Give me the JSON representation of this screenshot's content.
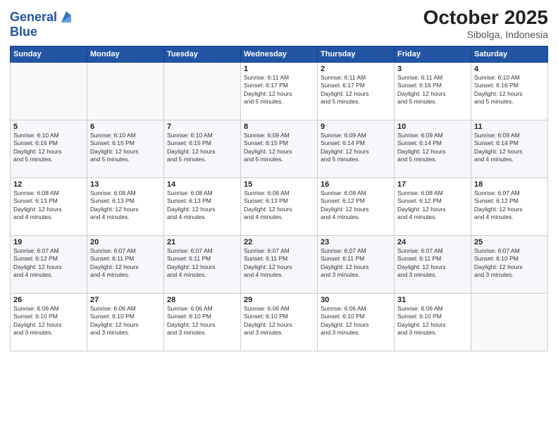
{
  "header": {
    "logo_line1": "General",
    "logo_line2": "Blue",
    "month": "October 2025",
    "location": "Sibolga, Indonesia"
  },
  "days_of_week": [
    "Sunday",
    "Monday",
    "Tuesday",
    "Wednesday",
    "Thursday",
    "Friday",
    "Saturday"
  ],
  "weeks": [
    [
      {
        "day": "",
        "info": ""
      },
      {
        "day": "",
        "info": ""
      },
      {
        "day": "",
        "info": ""
      },
      {
        "day": "1",
        "info": "Sunrise: 6:11 AM\nSunset: 6:17 PM\nDaylight: 12 hours\nand 5 minutes."
      },
      {
        "day": "2",
        "info": "Sunrise: 6:11 AM\nSunset: 6:17 PM\nDaylight: 12 hours\nand 5 minutes."
      },
      {
        "day": "3",
        "info": "Sunrise: 6:11 AM\nSunset: 6:16 PM\nDaylight: 12 hours\nand 5 minutes."
      },
      {
        "day": "4",
        "info": "Sunrise: 6:10 AM\nSunset: 6:16 PM\nDaylight: 12 hours\nand 5 minutes."
      }
    ],
    [
      {
        "day": "5",
        "info": "Sunrise: 6:10 AM\nSunset: 6:16 PM\nDaylight: 12 hours\nand 5 minutes."
      },
      {
        "day": "6",
        "info": "Sunrise: 6:10 AM\nSunset: 6:15 PM\nDaylight: 12 hours\nand 5 minutes."
      },
      {
        "day": "7",
        "info": "Sunrise: 6:10 AM\nSunset: 6:15 PM\nDaylight: 12 hours\nand 5 minutes."
      },
      {
        "day": "8",
        "info": "Sunrise: 6:09 AM\nSunset: 6:15 PM\nDaylight: 12 hours\nand 5 minutes."
      },
      {
        "day": "9",
        "info": "Sunrise: 6:09 AM\nSunset: 6:14 PM\nDaylight: 12 hours\nand 5 minutes."
      },
      {
        "day": "10",
        "info": "Sunrise: 6:09 AM\nSunset: 6:14 PM\nDaylight: 12 hours\nand 5 minutes."
      },
      {
        "day": "11",
        "info": "Sunrise: 6:09 AM\nSunset: 6:14 PM\nDaylight: 12 hours\nand 4 minutes."
      }
    ],
    [
      {
        "day": "12",
        "info": "Sunrise: 6:08 AM\nSunset: 6:13 PM\nDaylight: 12 hours\nand 4 minutes."
      },
      {
        "day": "13",
        "info": "Sunrise: 6:08 AM\nSunset: 6:13 PM\nDaylight: 12 hours\nand 4 minutes."
      },
      {
        "day": "14",
        "info": "Sunrise: 6:08 AM\nSunset: 6:13 PM\nDaylight: 12 hours\nand 4 minutes."
      },
      {
        "day": "15",
        "info": "Sunrise: 6:08 AM\nSunset: 6:13 PM\nDaylight: 12 hours\nand 4 minutes."
      },
      {
        "day": "16",
        "info": "Sunrise: 6:08 AM\nSunset: 6:12 PM\nDaylight: 12 hours\nand 4 minutes."
      },
      {
        "day": "17",
        "info": "Sunrise: 6:08 AM\nSunset: 6:12 PM\nDaylight: 12 hours\nand 4 minutes."
      },
      {
        "day": "18",
        "info": "Sunrise: 6:07 AM\nSunset: 6:12 PM\nDaylight: 12 hours\nand 4 minutes."
      }
    ],
    [
      {
        "day": "19",
        "info": "Sunrise: 6:07 AM\nSunset: 6:12 PM\nDaylight: 12 hours\nand 4 minutes."
      },
      {
        "day": "20",
        "info": "Sunrise: 6:07 AM\nSunset: 6:11 PM\nDaylight: 12 hours\nand 4 minutes."
      },
      {
        "day": "21",
        "info": "Sunrise: 6:07 AM\nSunset: 6:11 PM\nDaylight: 12 hours\nand 4 minutes."
      },
      {
        "day": "22",
        "info": "Sunrise: 6:07 AM\nSunset: 6:11 PM\nDaylight: 12 hours\nand 4 minutes."
      },
      {
        "day": "23",
        "info": "Sunrise: 6:07 AM\nSunset: 6:11 PM\nDaylight: 12 hours\nand 3 minutes."
      },
      {
        "day": "24",
        "info": "Sunrise: 6:07 AM\nSunset: 6:11 PM\nDaylight: 12 hours\nand 3 minutes."
      },
      {
        "day": "25",
        "info": "Sunrise: 6:07 AM\nSunset: 6:10 PM\nDaylight: 12 hours\nand 3 minutes."
      }
    ],
    [
      {
        "day": "26",
        "info": "Sunrise: 6:06 AM\nSunset: 6:10 PM\nDaylight: 12 hours\nand 3 minutes."
      },
      {
        "day": "27",
        "info": "Sunrise: 6:06 AM\nSunset: 6:10 PM\nDaylight: 12 hours\nand 3 minutes."
      },
      {
        "day": "28",
        "info": "Sunrise: 6:06 AM\nSunset: 6:10 PM\nDaylight: 12 hours\nand 3 minutes."
      },
      {
        "day": "29",
        "info": "Sunrise: 6:06 AM\nSunset: 6:10 PM\nDaylight: 12 hours\nand 3 minutes."
      },
      {
        "day": "30",
        "info": "Sunrise: 6:06 AM\nSunset: 6:10 PM\nDaylight: 12 hours\nand 3 minutes."
      },
      {
        "day": "31",
        "info": "Sunrise: 6:06 AM\nSunset: 6:10 PM\nDaylight: 12 hours\nand 3 minutes."
      },
      {
        "day": "",
        "info": ""
      }
    ]
  ]
}
